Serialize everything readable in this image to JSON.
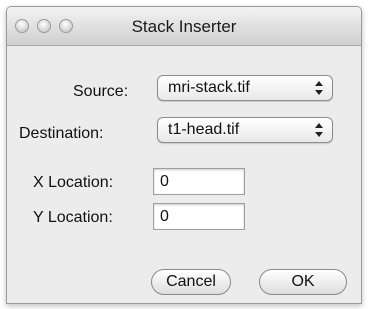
{
  "window": {
    "title": "Stack Inserter"
  },
  "form": {
    "source_label": "Source:",
    "source_value": "mri-stack.tif",
    "destination_label": "Destination:",
    "destination_value": "t1-head.tif",
    "x_label": "X Location:",
    "x_value": "0",
    "y_label": "Y Location:",
    "y_value": "0"
  },
  "buttons": {
    "cancel": "Cancel",
    "ok": "OK"
  }
}
